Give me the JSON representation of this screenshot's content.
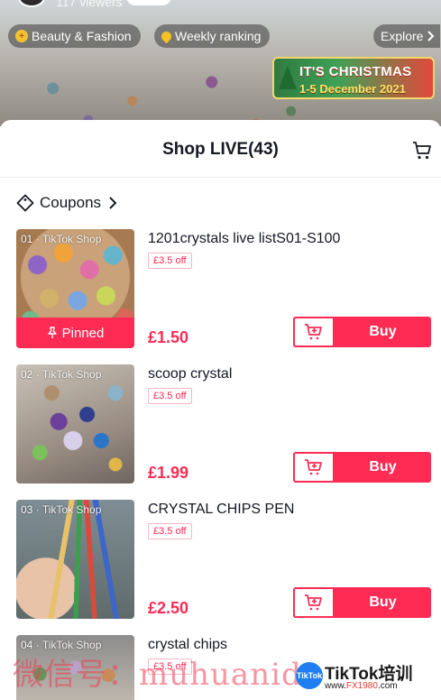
{
  "live": {
    "viewers": "117 viewers",
    "chips": [
      {
        "label": "Beauty & Fashion",
        "icon": "plus-badge-icon"
      },
      {
        "label": "Weekly ranking",
        "icon": "drop-badge-icon"
      },
      {
        "label": "Explore",
        "icon": "chevron-right-icon"
      }
    ],
    "banner": {
      "title": "IT'S CHRISTMAS",
      "date": "1-5 December 2021"
    }
  },
  "sheet": {
    "title": "Shop LIVE(43)",
    "cart_icon": "shopping-cart-icon",
    "coupons_label": "Coupons"
  },
  "products": [
    {
      "index": "01",
      "store_tag": "TikTok Shop",
      "title": "1201crystals live listS01-S100",
      "coupon": "£3.5 off",
      "price": "£1.50",
      "buy_label": "Buy",
      "pinned_label": "Pinned"
    },
    {
      "index": "02",
      "store_tag": "TikTok Shop",
      "title": "scoop crystal",
      "coupon": "£3.5 off",
      "price": "£1.99",
      "buy_label": "Buy"
    },
    {
      "index": "03",
      "store_tag": "TikTok Shop",
      "title": "CRYSTAL CHIPS PEN",
      "coupon": "£3.5 off",
      "price": "£2.50",
      "buy_label": "Buy"
    },
    {
      "index": "04",
      "store_tag": "TikTok Shop",
      "title": "crystal chips",
      "coupon": "£3.5 off"
    }
  ],
  "watermark": {
    "text": "微信号：muhuanidc",
    "brand": "TikTok培训",
    "site_prefix": "www.",
    "site_mid": "FX1980",
    "site_suffix": ".com"
  },
  "colors": {
    "accent": "#fe2c55",
    "text": "#161823",
    "coupon_border": "#f4b8c4"
  }
}
